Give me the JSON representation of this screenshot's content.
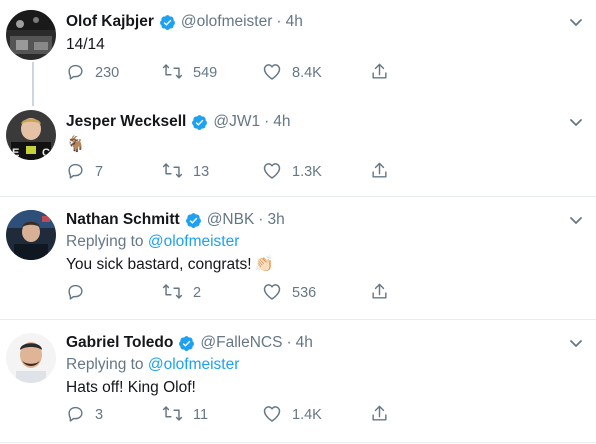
{
  "tweets": [
    {
      "name": "Olof Kajbjer",
      "handle": "@olofmeister",
      "time": "4h",
      "reply_prefix": "",
      "reply_to": "",
      "text": "14/14",
      "replies": "230",
      "retweets": "549",
      "likes": "8.4K",
      "verified": true
    },
    {
      "name": "Jesper Wecksell",
      "handle": "@JW1",
      "time": "4h",
      "reply_prefix": "",
      "reply_to": "",
      "text": "🐐",
      "replies": "7",
      "retweets": "13",
      "likes": "1.3K",
      "verified": true
    },
    {
      "name": "Nathan Schmitt",
      "handle": "@NBK",
      "time": "3h",
      "reply_prefix": "Replying to",
      "reply_to": "@olofmeister",
      "text": "You sick bastard, congrats!",
      "text_emoji": "👏🏻",
      "replies": "",
      "retweets": "2",
      "likes": "536",
      "verified": true
    },
    {
      "name": "Gabriel Toledo",
      "handle": "@FalleNCS",
      "time": "4h",
      "reply_prefix": "Replying to",
      "reply_to": "@olofmeister",
      "text": "Hats off! King Olof!",
      "replies": "3",
      "retweets": "11",
      "likes": "1.4K",
      "verified": true
    }
  ],
  "separator_char": "·",
  "icons": {
    "reply": "reply-icon",
    "retweet": "retweet-icon",
    "like": "heart-icon",
    "share": "share-icon",
    "verified": "verified-badge-icon",
    "menu": "chevron-down-icon"
  },
  "colors": {
    "text": "#14171a",
    "secondary": "#657786",
    "link": "#1da1f2",
    "verified": "#1da1f2",
    "border": "#e6ecf0"
  }
}
